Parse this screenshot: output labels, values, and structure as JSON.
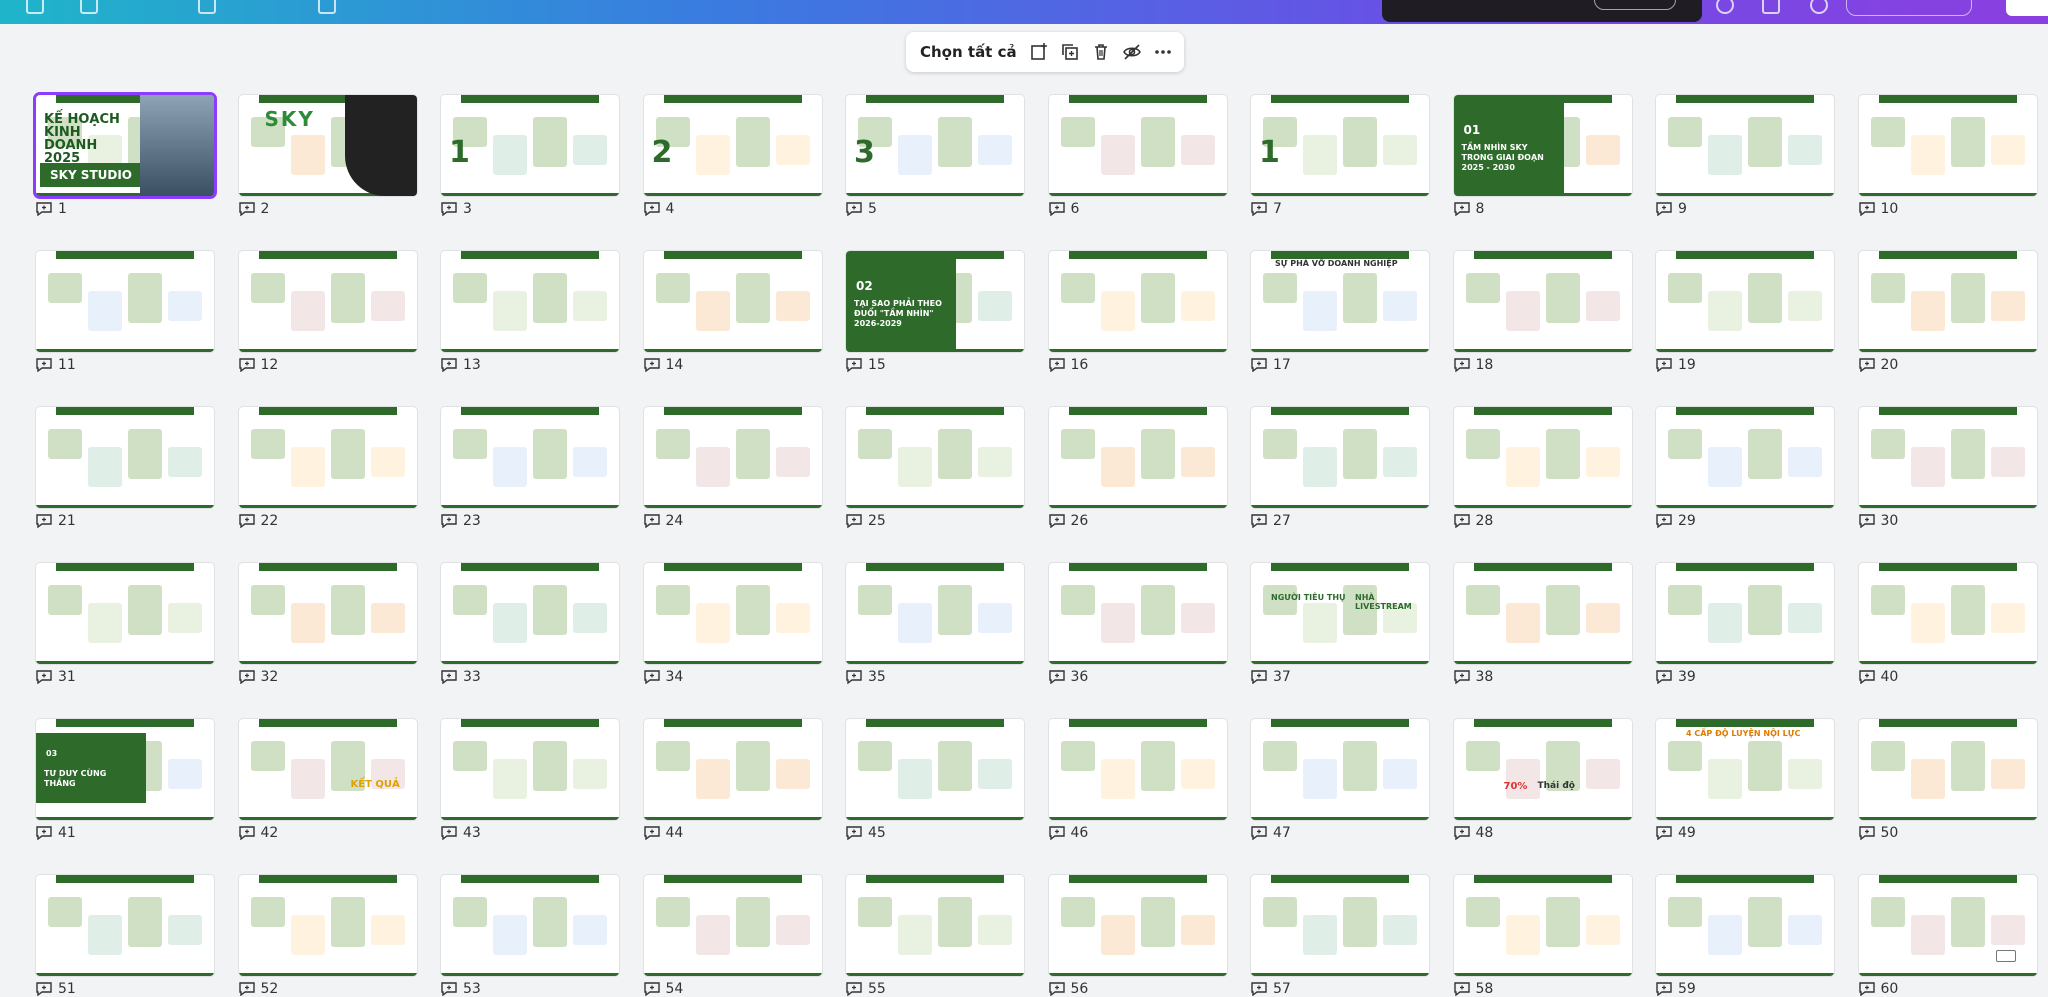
{
  "toolbar": {
    "select_all_label": "Chọn tất cả",
    "icons": [
      "add-page-icon",
      "duplicate-icon",
      "trash-icon",
      "hide-icon",
      "more-icon"
    ]
  },
  "slides": [
    {
      "number": "1",
      "selected": true
    },
    {
      "number": "2"
    },
    {
      "number": "3"
    },
    {
      "number": "4"
    },
    {
      "number": "5"
    },
    {
      "number": "6"
    },
    {
      "number": "7"
    },
    {
      "number": "8"
    },
    {
      "number": "9"
    },
    {
      "number": "10"
    },
    {
      "number": "11"
    },
    {
      "number": "12"
    },
    {
      "number": "13"
    },
    {
      "number": "14"
    },
    {
      "number": "15"
    },
    {
      "number": "16"
    },
    {
      "number": "17"
    },
    {
      "number": "18"
    },
    {
      "number": "19"
    },
    {
      "number": "20"
    },
    {
      "number": "21"
    },
    {
      "number": "22"
    },
    {
      "number": "23"
    },
    {
      "number": "24"
    },
    {
      "number": "25"
    },
    {
      "number": "26"
    },
    {
      "number": "27"
    },
    {
      "number": "28"
    },
    {
      "number": "29"
    },
    {
      "number": "30"
    },
    {
      "number": "31"
    },
    {
      "number": "32"
    },
    {
      "number": "33"
    },
    {
      "number": "34"
    },
    {
      "number": "35"
    },
    {
      "number": "36"
    },
    {
      "number": "37"
    },
    {
      "number": "38"
    },
    {
      "number": "39"
    },
    {
      "number": "40"
    },
    {
      "number": "41"
    },
    {
      "number": "42"
    },
    {
      "number": "43"
    },
    {
      "number": "44"
    },
    {
      "number": "45"
    },
    {
      "number": "46"
    },
    {
      "number": "47"
    },
    {
      "number": "48"
    },
    {
      "number": "49"
    },
    {
      "number": "50"
    },
    {
      "number": "51"
    },
    {
      "number": "52"
    },
    {
      "number": "53"
    },
    {
      "number": "54"
    },
    {
      "number": "55"
    },
    {
      "number": "56"
    },
    {
      "number": "57"
    },
    {
      "number": "58"
    },
    {
      "number": "59"
    },
    {
      "number": "60"
    }
  ],
  "slide_texts": {
    "s1_title": "KẾ HOẠCH KINH DOANH 2025",
    "s1_band": "SKY STUDIO",
    "s2_brand": "SKY",
    "s3_num": "1",
    "s4_num": "2",
    "s5_num": "3",
    "s7_num": "1",
    "s8_title": "TẦM NHÌN SKY TRONG GIAI ĐOẠN 2025 - 2030",
    "s15_title": "TẠI SAO PHẢI THEO ĐUỔI \"TẦM NHÌN\" 2026-2029",
    "s41_title": "TƯ DUY CÙNG THẮNG",
    "s41_num": "03",
    "s8_num": "01",
    "s15_num": "02",
    "s17_title": "SỰ PHÁ VỠ DOANH NGHIỆP",
    "s37_left": "NGƯỜI TIÊU THỤ",
    "s37_right": "NHÀ LIVESTREAM",
    "s48_pct": "70%",
    "s48_word": "Thái độ",
    "s49_title": "4 CẤP ĐỘ LUYỆN NỘI LỰC",
    "s42_result": "KẾT QUẢ"
  }
}
